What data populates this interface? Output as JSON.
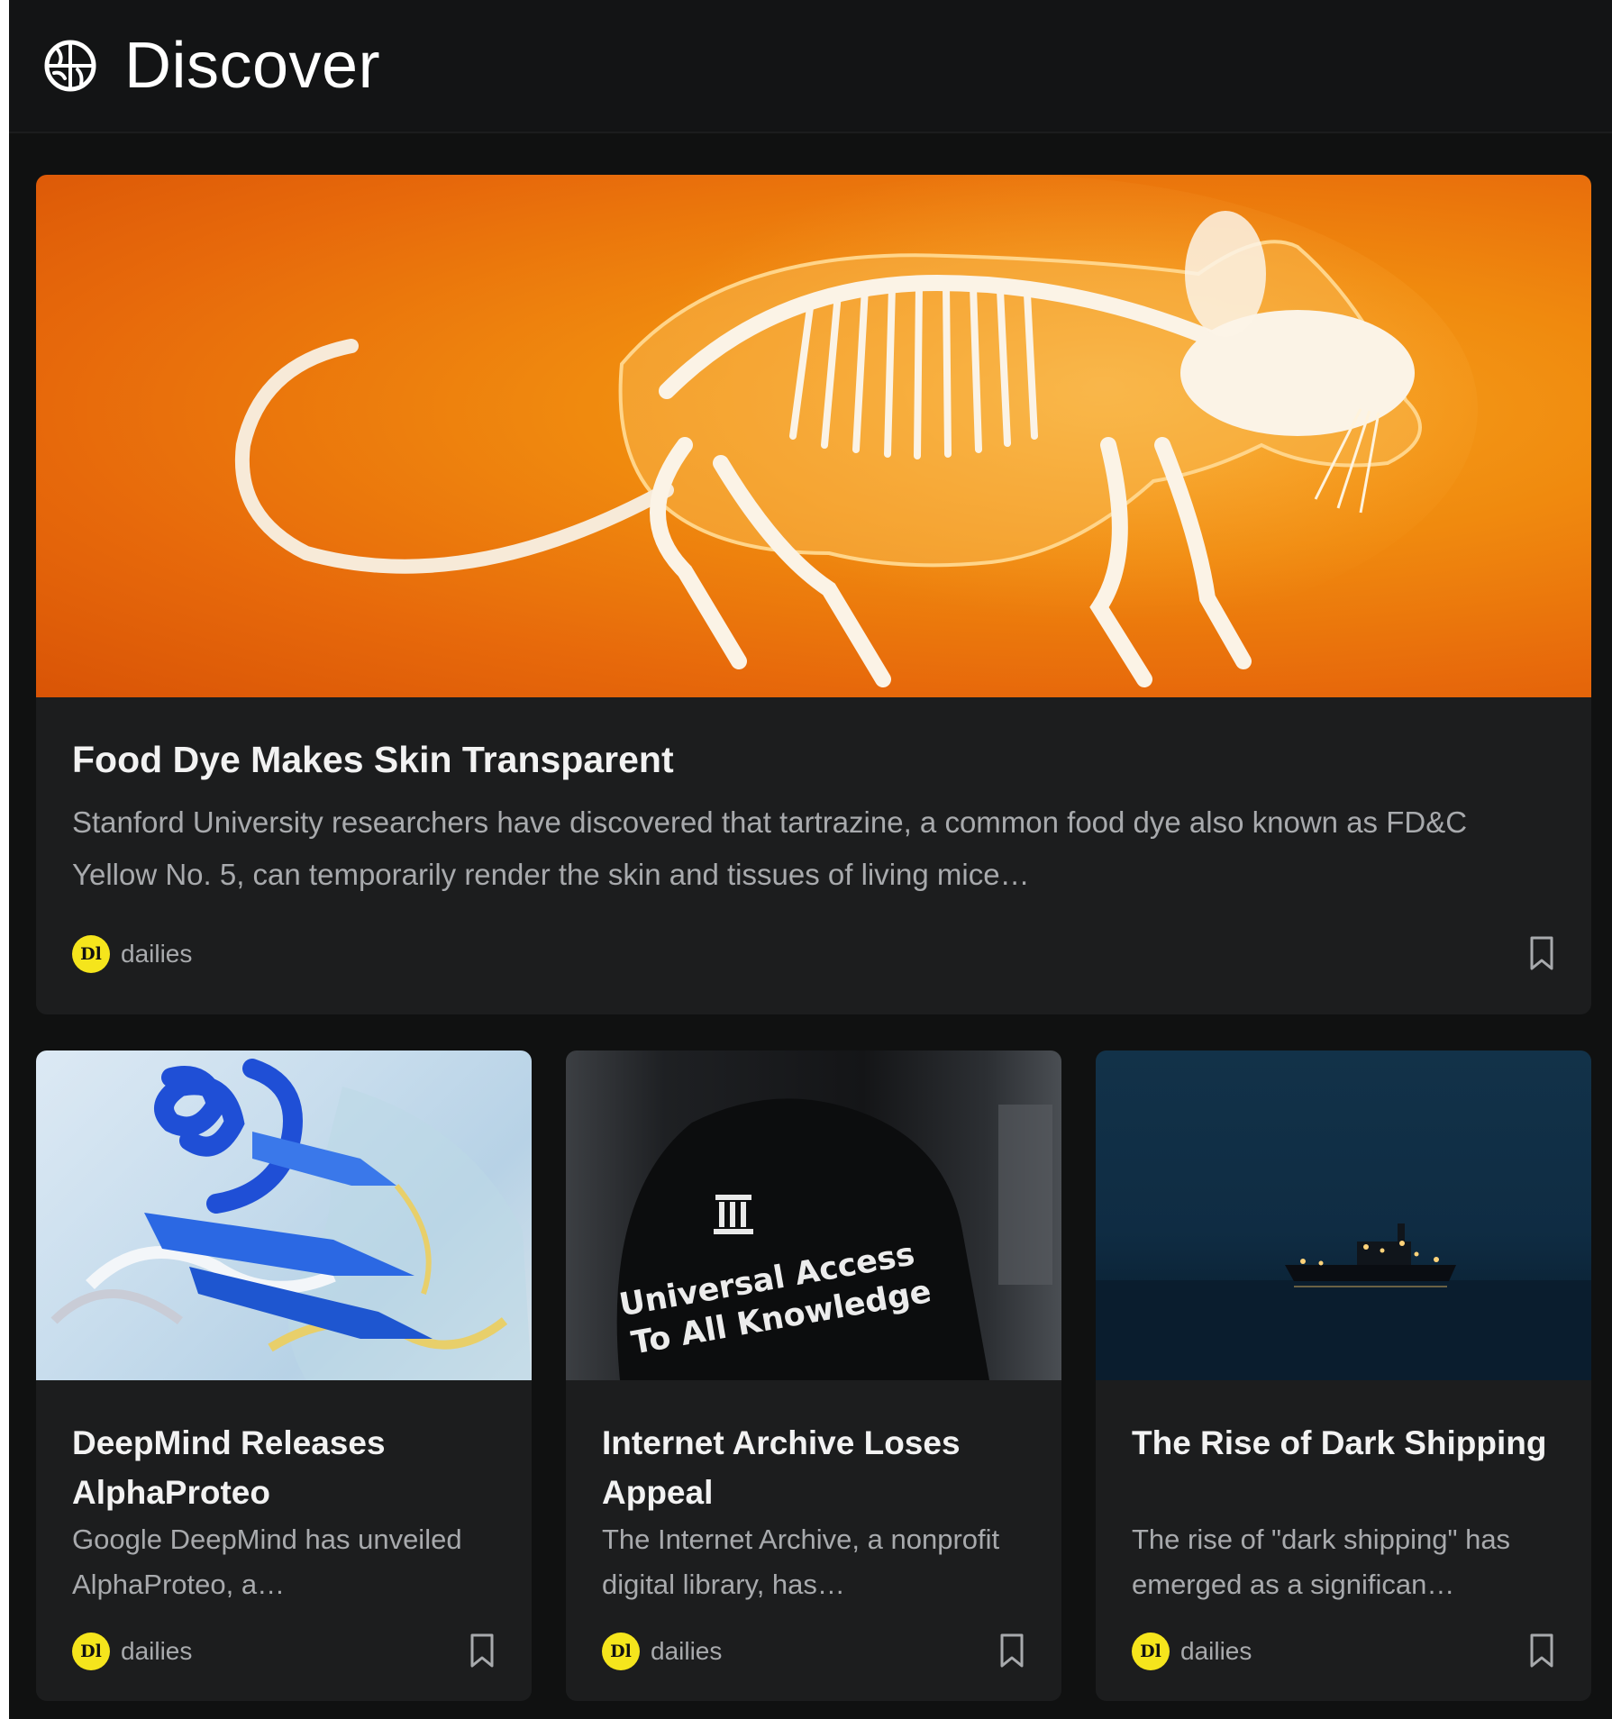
{
  "header": {
    "icon": "globe-icon",
    "title": "Discover"
  },
  "colors": {
    "background": "#101111",
    "card": "#1c1d1e",
    "source_avatar": "#f5e51c",
    "feature_accent": "#f08a0e"
  },
  "featured": {
    "title": "Food Dye Makes Skin Transparent",
    "description": "Stanford University researchers have discovered that tartrazine, a common food dye also known as FD&C Yellow No. 5, can temporarily render the skin and tissues of living mice…",
    "source": {
      "name": "dailies",
      "avatar_text": "Dl"
    }
  },
  "articles": [
    {
      "title": "DeepMind Releases AlphaProteo",
      "description": "Google DeepMind has unveiled AlphaProteo, a…",
      "source": {
        "name": "dailies",
        "avatar_text": "Dl"
      }
    },
    {
      "title": "Internet Archive Loses Appeal",
      "description": "The Internet Archive, a nonprofit digital library, has…",
      "shirt_text_line1": "Universal Access",
      "shirt_text_line2": "To All Knowledge",
      "source": {
        "name": "dailies",
        "avatar_text": "Dl"
      }
    },
    {
      "title": "The Rise of Dark Shipping",
      "description": "The rise of \"dark shipping\" has emerged as a significan…",
      "source": {
        "name": "dailies",
        "avatar_text": "Dl"
      }
    }
  ]
}
